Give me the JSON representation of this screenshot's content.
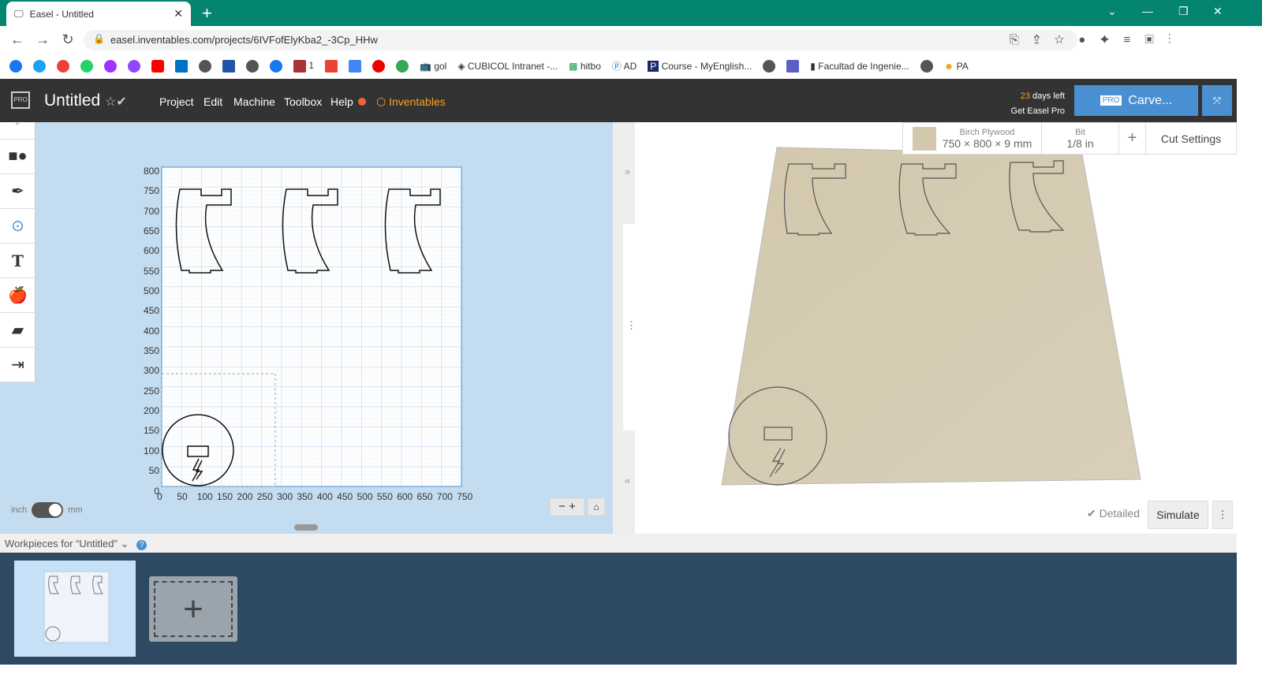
{
  "browser": {
    "tab_title": "Easel - Untitled",
    "url": "easel.inventables.com/projects/6IVFofElyKba2_-3Cp_HHw",
    "bookmarks": [
      "1",
      "gol",
      "CUBICOL Intranet -...",
      "hitbo",
      "AD",
      "Course - MyEnglish...",
      "Facultad de Ingenie...",
      "PA"
    ]
  },
  "app": {
    "title": "Untitled",
    "menu": [
      "Project",
      "Edit",
      "Machine",
      "Toolbox",
      "Help",
      "Inventables"
    ],
    "trial_days": "23",
    "trial_text": "days left",
    "get_pro": "Get Easel Pro",
    "pro_badge": "PRO",
    "carve": "Carve..."
  },
  "material": {
    "name": "Birch Plywood",
    "size": "750 × 800 × 9 mm",
    "bit_label": "Bit",
    "bit": "1/8 in",
    "add": "+",
    "cut_settings": "Cut Settings"
  },
  "canvas": {
    "y_ticks": [
      "800",
      "750",
      "700",
      "650",
      "600",
      "550",
      "500",
      "450",
      "400",
      "350",
      "300",
      "250",
      "200",
      "150",
      "100",
      "50",
      "0"
    ],
    "x_ticks": [
      "0",
      "50",
      "100",
      "150",
      "200",
      "250",
      "300",
      "350",
      "400",
      "450",
      "500",
      "550",
      "600",
      "650",
      "700",
      "750"
    ],
    "unit_left": "inch",
    "unit_right": "mm",
    "unit_selected": "mm"
  },
  "preview": {
    "detailed": "Detailed",
    "simulate": "Simulate"
  },
  "workpieces": {
    "label": "Workpieces for “Untitled”",
    "help": "?"
  },
  "colors": {
    "tab_bar": "#03856f",
    "header": "#333333",
    "canvas_bg": "#c4dcf0",
    "carve": "#4a8fd1",
    "bottom": "#2d4a62",
    "inventables": "#f5a623"
  }
}
